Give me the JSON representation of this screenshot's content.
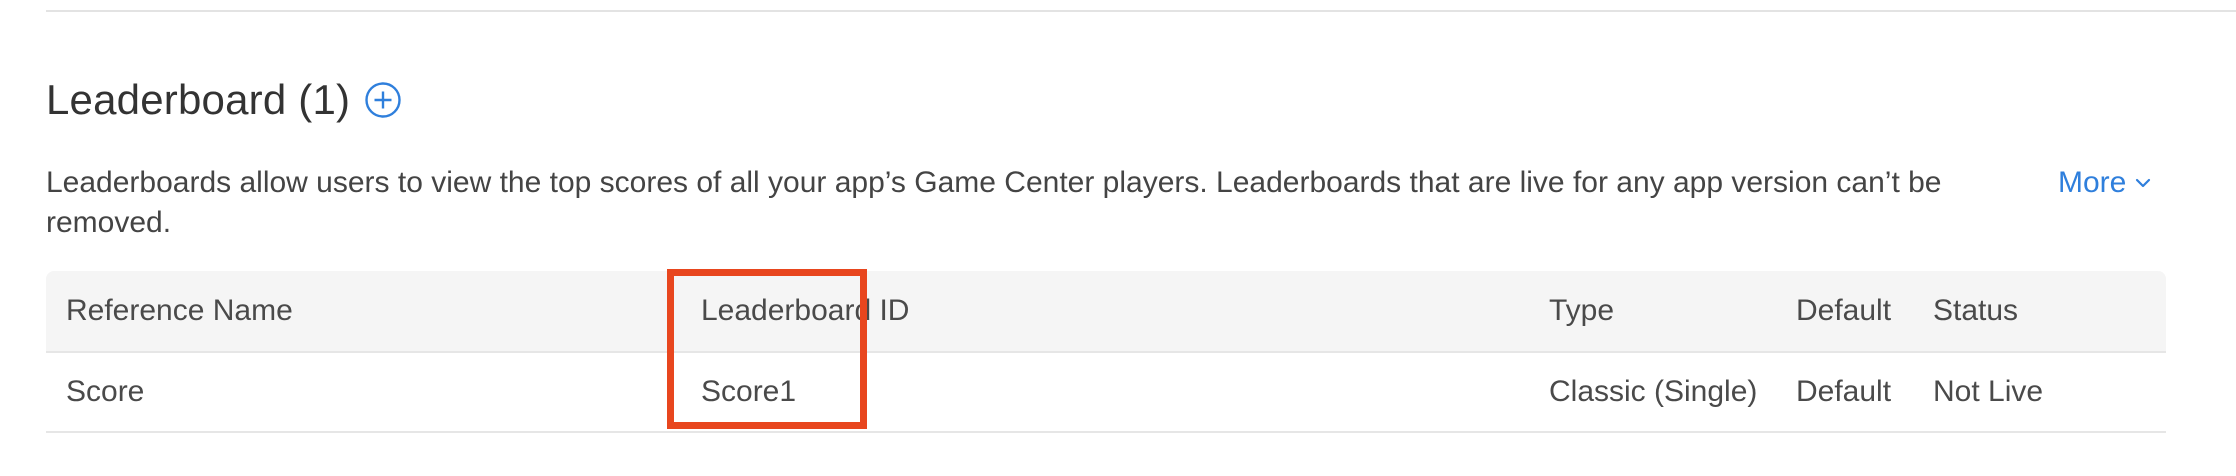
{
  "section": {
    "title": "Leaderboard (1)",
    "add_icon": "plus-circle-icon",
    "description": "Leaderboards allow users to view the top scores of all your app’s Game Center players. Leaderboards that are live for any app version can’t be removed.",
    "more_label": "More",
    "more_icon": "chevron-down-icon"
  },
  "table": {
    "columns": [
      "Reference Name",
      "Leaderboard ID",
      "Type",
      "Default",
      "Status"
    ],
    "rows": [
      {
        "reference_name": "Score",
        "leaderboard_id": "Score1",
        "type": "Classic (Single)",
        "default": "Default",
        "status": "Not Live"
      }
    ]
  },
  "colors": {
    "accent": "#2f7fdc",
    "highlight": "#e8461e",
    "header_bg": "#f5f5f5"
  }
}
